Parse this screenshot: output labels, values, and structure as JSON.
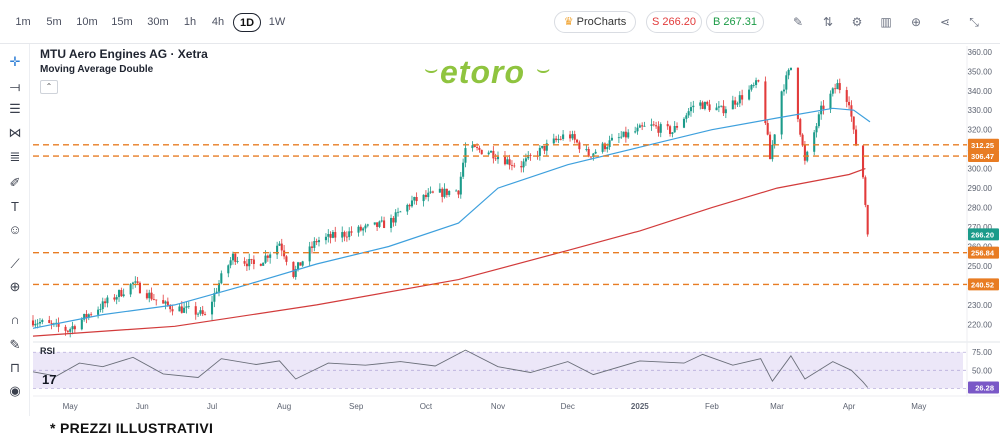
{
  "toolbar": {
    "timeframes": [
      "1m",
      "5m",
      "10m",
      "15m",
      "30m",
      "1h",
      "4h",
      "1D",
      "1W"
    ],
    "active_timeframe": "1D",
    "procharts_label": "ProCharts",
    "sell_label": "S 266.20",
    "buy_label": "B 267.31",
    "colors": {
      "sell": "#e23b3b",
      "buy": "#1b9b46",
      "crown": "#f0a22e"
    }
  },
  "left_tools": [
    "crosshair-icon",
    "trend-line-icon",
    "horizontal-lines-icon",
    "pattern-icon",
    "fib-icon",
    "brush-icon",
    "text-icon",
    "emoji-icon",
    "ruler-icon",
    "zoom-icon",
    "magnet-icon",
    "lock-draw-icon",
    "lock-icon",
    "eye-icon"
  ],
  "header": {
    "title": "MTU Aero Engines AG · Xetra",
    "indicator": "Moving Average Double"
  },
  "logo_text": "etoro",
  "footnote": "* PREZZI ILLUSTRATIVI",
  "chart_data": {
    "type": "candlestick",
    "ylim": [
      213,
      363
    ],
    "yticks": [
      220,
      230,
      240,
      250,
      260,
      270,
      280,
      290,
      300,
      310,
      320,
      330,
      340,
      350,
      360
    ],
    "ytick_labels": [
      "220.00",
      "230.00",
      "240.00",
      "250.00",
      "260.00",
      "270.00",
      "280.00",
      "290.00",
      "300.00",
      "310.00",
      "320.00",
      "330.00",
      "340.00",
      "350.00",
      "360.00"
    ],
    "x_range": [
      "2024-04-15",
      "2025-05-20"
    ],
    "xticks": [
      {
        "date": "2024-05-01",
        "label": "May"
      },
      {
        "date": "2024-06-01",
        "label": "Jun"
      },
      {
        "date": "2024-07-01",
        "label": "Jul"
      },
      {
        "date": "2024-08-01",
        "label": "Aug"
      },
      {
        "date": "2024-09-01",
        "label": "Sep"
      },
      {
        "date": "2024-10-01",
        "label": "Oct"
      },
      {
        "date": "2024-11-01",
        "label": "Nov"
      },
      {
        "date": "2024-12-01",
        "label": "Dec"
      },
      {
        "date": "2025-01-01",
        "label": "2025"
      },
      {
        "date": "2025-02-01",
        "label": "Feb"
      },
      {
        "date": "2025-03-01",
        "label": "Mar"
      },
      {
        "date": "2025-04-01",
        "label": "Apr"
      },
      {
        "date": "2025-05-01",
        "label": "May"
      }
    ],
    "close_path": [
      [
        "2024-04-15",
        222
      ],
      [
        "2024-04-30",
        217
      ],
      [
        "2024-05-10",
        226
      ],
      [
        "2024-05-20",
        234
      ],
      [
        "2024-05-28",
        241
      ],
      [
        "2024-06-10",
        230
      ],
      [
        "2024-06-25",
        226
      ],
      [
        "2024-06-28",
        224
      ],
      [
        "2024-07-05",
        244
      ],
      [
        "2024-07-10",
        255
      ],
      [
        "2024-07-20",
        250
      ],
      [
        "2024-07-30",
        262
      ],
      [
        "2024-08-05",
        246
      ],
      [
        "2024-08-15",
        263
      ],
      [
        "2024-09-01",
        268
      ],
      [
        "2024-09-15",
        272
      ],
      [
        "2024-09-25",
        283
      ],
      [
        "2024-10-05",
        287
      ],
      [
        "2024-10-15",
        289
      ],
      [
        "2024-10-18",
        310
      ],
      [
        "2024-10-28",
        309
      ],
      [
        "2024-11-10",
        301
      ],
      [
        "2024-11-20",
        310
      ],
      [
        "2024-12-01",
        318
      ],
      [
        "2024-12-10",
        307
      ],
      [
        "2024-12-20",
        314
      ],
      [
        "2025-01-05",
        322
      ],
      [
        "2025-01-15",
        319
      ],
      [
        "2025-01-25",
        334
      ],
      [
        "2025-02-05",
        330
      ],
      [
        "2025-02-15",
        338
      ],
      [
        "2025-02-22",
        345
      ],
      [
        "2025-02-26",
        305
      ],
      [
        "2025-03-03",
        340
      ],
      [
        "2025-03-07",
        352
      ],
      [
        "2025-03-13",
        303
      ],
      [
        "2025-03-20",
        330
      ],
      [
        "2025-03-27",
        343
      ],
      [
        "2025-04-01",
        335
      ],
      [
        "2025-04-03",
        318
      ],
      [
        "2025-04-07",
        296
      ],
      [
        "2025-04-08",
        282
      ],
      [
        "2025-04-09",
        266.2
      ]
    ],
    "series": [
      {
        "name": "MA short",
        "color": "#3ea0dd",
        "points": [
          [
            "2024-04-15",
            218
          ],
          [
            "2024-05-15",
            225
          ],
          [
            "2024-06-15",
            230
          ],
          [
            "2024-07-15",
            240
          ],
          [
            "2024-08-15",
            251
          ],
          [
            "2024-09-15",
            260
          ],
          [
            "2024-10-15",
            272
          ],
          [
            "2024-11-01",
            290
          ],
          [
            "2024-12-01",
            302
          ],
          [
            "2025-01-01",
            311
          ],
          [
            "2025-02-01",
            320
          ],
          [
            "2025-03-01",
            326
          ],
          [
            "2025-03-25",
            331
          ],
          [
            "2025-04-03",
            330
          ],
          [
            "2025-04-10",
            324
          ]
        ]
      },
      {
        "name": "MA long",
        "color": "#d23b3b",
        "points": [
          [
            "2024-04-15",
            214
          ],
          [
            "2024-06-15",
            219
          ],
          [
            "2024-08-15",
            230
          ],
          [
            "2024-10-15",
            243
          ],
          [
            "2024-12-01",
            258
          ],
          [
            "2025-01-01",
            268
          ],
          [
            "2025-02-01",
            280
          ],
          [
            "2025-03-01",
            290
          ],
          [
            "2025-04-01",
            297
          ],
          [
            "2025-04-08",
            300
          ]
        ]
      }
    ],
    "price_lines": [
      {
        "value": 312.25,
        "label": "312.25",
        "color": "#e87c23"
      },
      {
        "value": 306.47,
        "label": "306.47",
        "color": "#e87c23"
      },
      {
        "value": 256.84,
        "label": "256.84",
        "color": "#e87c23"
      },
      {
        "value": 240.52,
        "label": "240.52",
        "color": "#e87c23"
      }
    ],
    "last_price": {
      "value": 266.2,
      "label": "266.20",
      "color": "#1b9b8a"
    },
    "up_color": "#1b9b8a",
    "down_color": "#e23b3b",
    "rsi": {
      "label": "RSI",
      "ylim": [
        20,
        85
      ],
      "yticks": [
        75,
        50,
        25
      ],
      "ytick_labels": [
        "75.00",
        "50.00",
        "25.00"
      ],
      "band": [
        25,
        75
      ],
      "last": {
        "value": 26.28,
        "label": "26.28",
        "color": "#7a58c7"
      },
      "points": [
        [
          "2024-04-15",
          48
        ],
        [
          "2024-04-25",
          42
        ],
        [
          "2024-05-05",
          60
        ],
        [
          "2024-05-15",
          55
        ],
        [
          "2024-05-28",
          68
        ],
        [
          "2024-06-10",
          45
        ],
        [
          "2024-06-25",
          40
        ],
        [
          "2024-07-05",
          66
        ],
        [
          "2024-07-20",
          58
        ],
        [
          "2024-07-30",
          63
        ],
        [
          "2024-08-06",
          38
        ],
        [
          "2024-08-20",
          60
        ],
        [
          "2024-09-05",
          57
        ],
        [
          "2024-09-20",
          62
        ],
        [
          "2024-10-05",
          56
        ],
        [
          "2024-10-18",
          78
        ],
        [
          "2024-11-01",
          55
        ],
        [
          "2024-11-15",
          47
        ],
        [
          "2024-12-01",
          62
        ],
        [
          "2024-12-12",
          44
        ],
        [
          "2025-01-01",
          63
        ],
        [
          "2025-01-20",
          60
        ],
        [
          "2025-01-28",
          72
        ],
        [
          "2025-02-10",
          57
        ],
        [
          "2025-02-22",
          66
        ],
        [
          "2025-02-27",
          35
        ],
        [
          "2025-03-07",
          70
        ],
        [
          "2025-03-13",
          38
        ],
        [
          "2025-03-25",
          62
        ],
        [
          "2025-04-02",
          50
        ],
        [
          "2025-04-07",
          34
        ],
        [
          "2025-04-09",
          26.28
        ]
      ]
    }
  }
}
